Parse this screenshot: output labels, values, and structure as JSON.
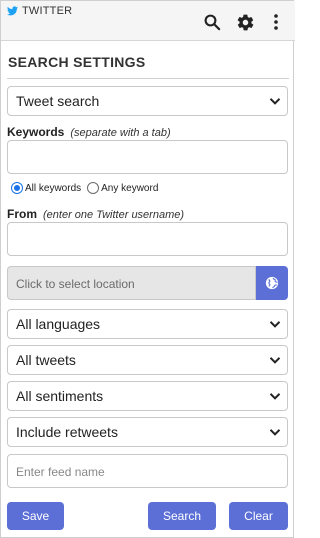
{
  "header": {
    "brand": "TWITTER",
    "icons": [
      "twitter-bird-icon",
      "search-icon",
      "gear-icon",
      "more-vertical-icon"
    ]
  },
  "section_title": "SEARCH SETTINGS",
  "search_type": {
    "selected": "Tweet search"
  },
  "keywords": {
    "label": "Keywords",
    "hint": "(separate with a tab)",
    "value": "",
    "match_options": [
      {
        "label": "All keywords",
        "selected": true
      },
      {
        "label": "Any keyword",
        "selected": false
      }
    ]
  },
  "from": {
    "label": "From",
    "hint": "(enter one Twitter username)",
    "value": ""
  },
  "location": {
    "placeholder": "Click to select location",
    "button_icon": "globe-icon"
  },
  "filters": {
    "language": "All languages",
    "tweet_type": "All tweets",
    "sentiment": "All sentiments",
    "retweets": "Include retweets"
  },
  "feed_name": {
    "placeholder": "Enter feed name",
    "value": ""
  },
  "actions": {
    "save": "Save",
    "search": "Search",
    "clear": "Clear"
  },
  "colors": {
    "accent": "#5b6fd6",
    "twitter_blue": "#1da1f2",
    "radio_blue": "#1a73e8"
  }
}
